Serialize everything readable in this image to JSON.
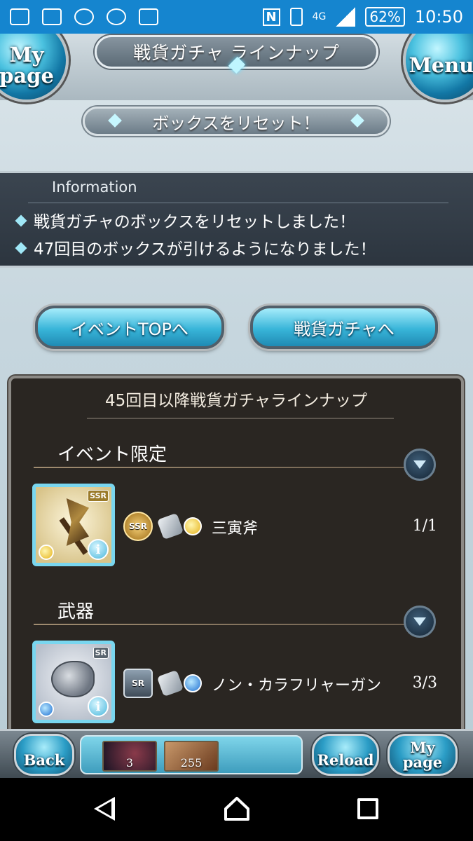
{
  "status_bar": {
    "network": "4G",
    "battery": "62%",
    "time": "10:50",
    "nfc_label": "N",
    "left_icons": [
      "carrier-mail-icon",
      "gallery-icon",
      "browser-icon",
      "cloud-check-icon",
      "mail-icon"
    ]
  },
  "header": {
    "title": "戦貨ガチャ ラインナップ",
    "mypage_label": "My page",
    "menu_label": "Menu"
  },
  "reset_button": {
    "label": "ボックスをリセット！"
  },
  "information": {
    "heading": "Information",
    "lines": [
      "戦貨ガチャのボックスをリセットしました！",
      "47回目のボックスが引けるようになりました！"
    ]
  },
  "nav_buttons": {
    "event_top": "イベントTOPへ",
    "gacha": "戦貨ガチャへ"
  },
  "lineup": {
    "title": "45回目以降戦貨ガチャラインナップ",
    "sections": [
      {
        "heading": "イベント限定",
        "items": [
          {
            "rarity": "SSR",
            "thumb_rarity": "SSR",
            "weapon_type": "axe-icon",
            "element": "light",
            "name": "三寅斧",
            "count": "1/1"
          }
        ]
      },
      {
        "heading": "武器",
        "items": [
          {
            "rarity": "SR",
            "thumb_rarity": "SR",
            "weapon_type": "gun-icon",
            "element": "water",
            "name": "ノン・カラフリャーガン",
            "count": "3/3"
          }
        ]
      }
    ]
  },
  "bottom_bar": {
    "back_label": "Back",
    "reload_label": "Reload",
    "mypage_label": "My page",
    "slot1_count": "3",
    "slot2_count": "255"
  },
  "colors": {
    "status_bar": "#1585cf",
    "accent_cyan": "#38b5d9",
    "panel_dark": "#2a2622"
  }
}
